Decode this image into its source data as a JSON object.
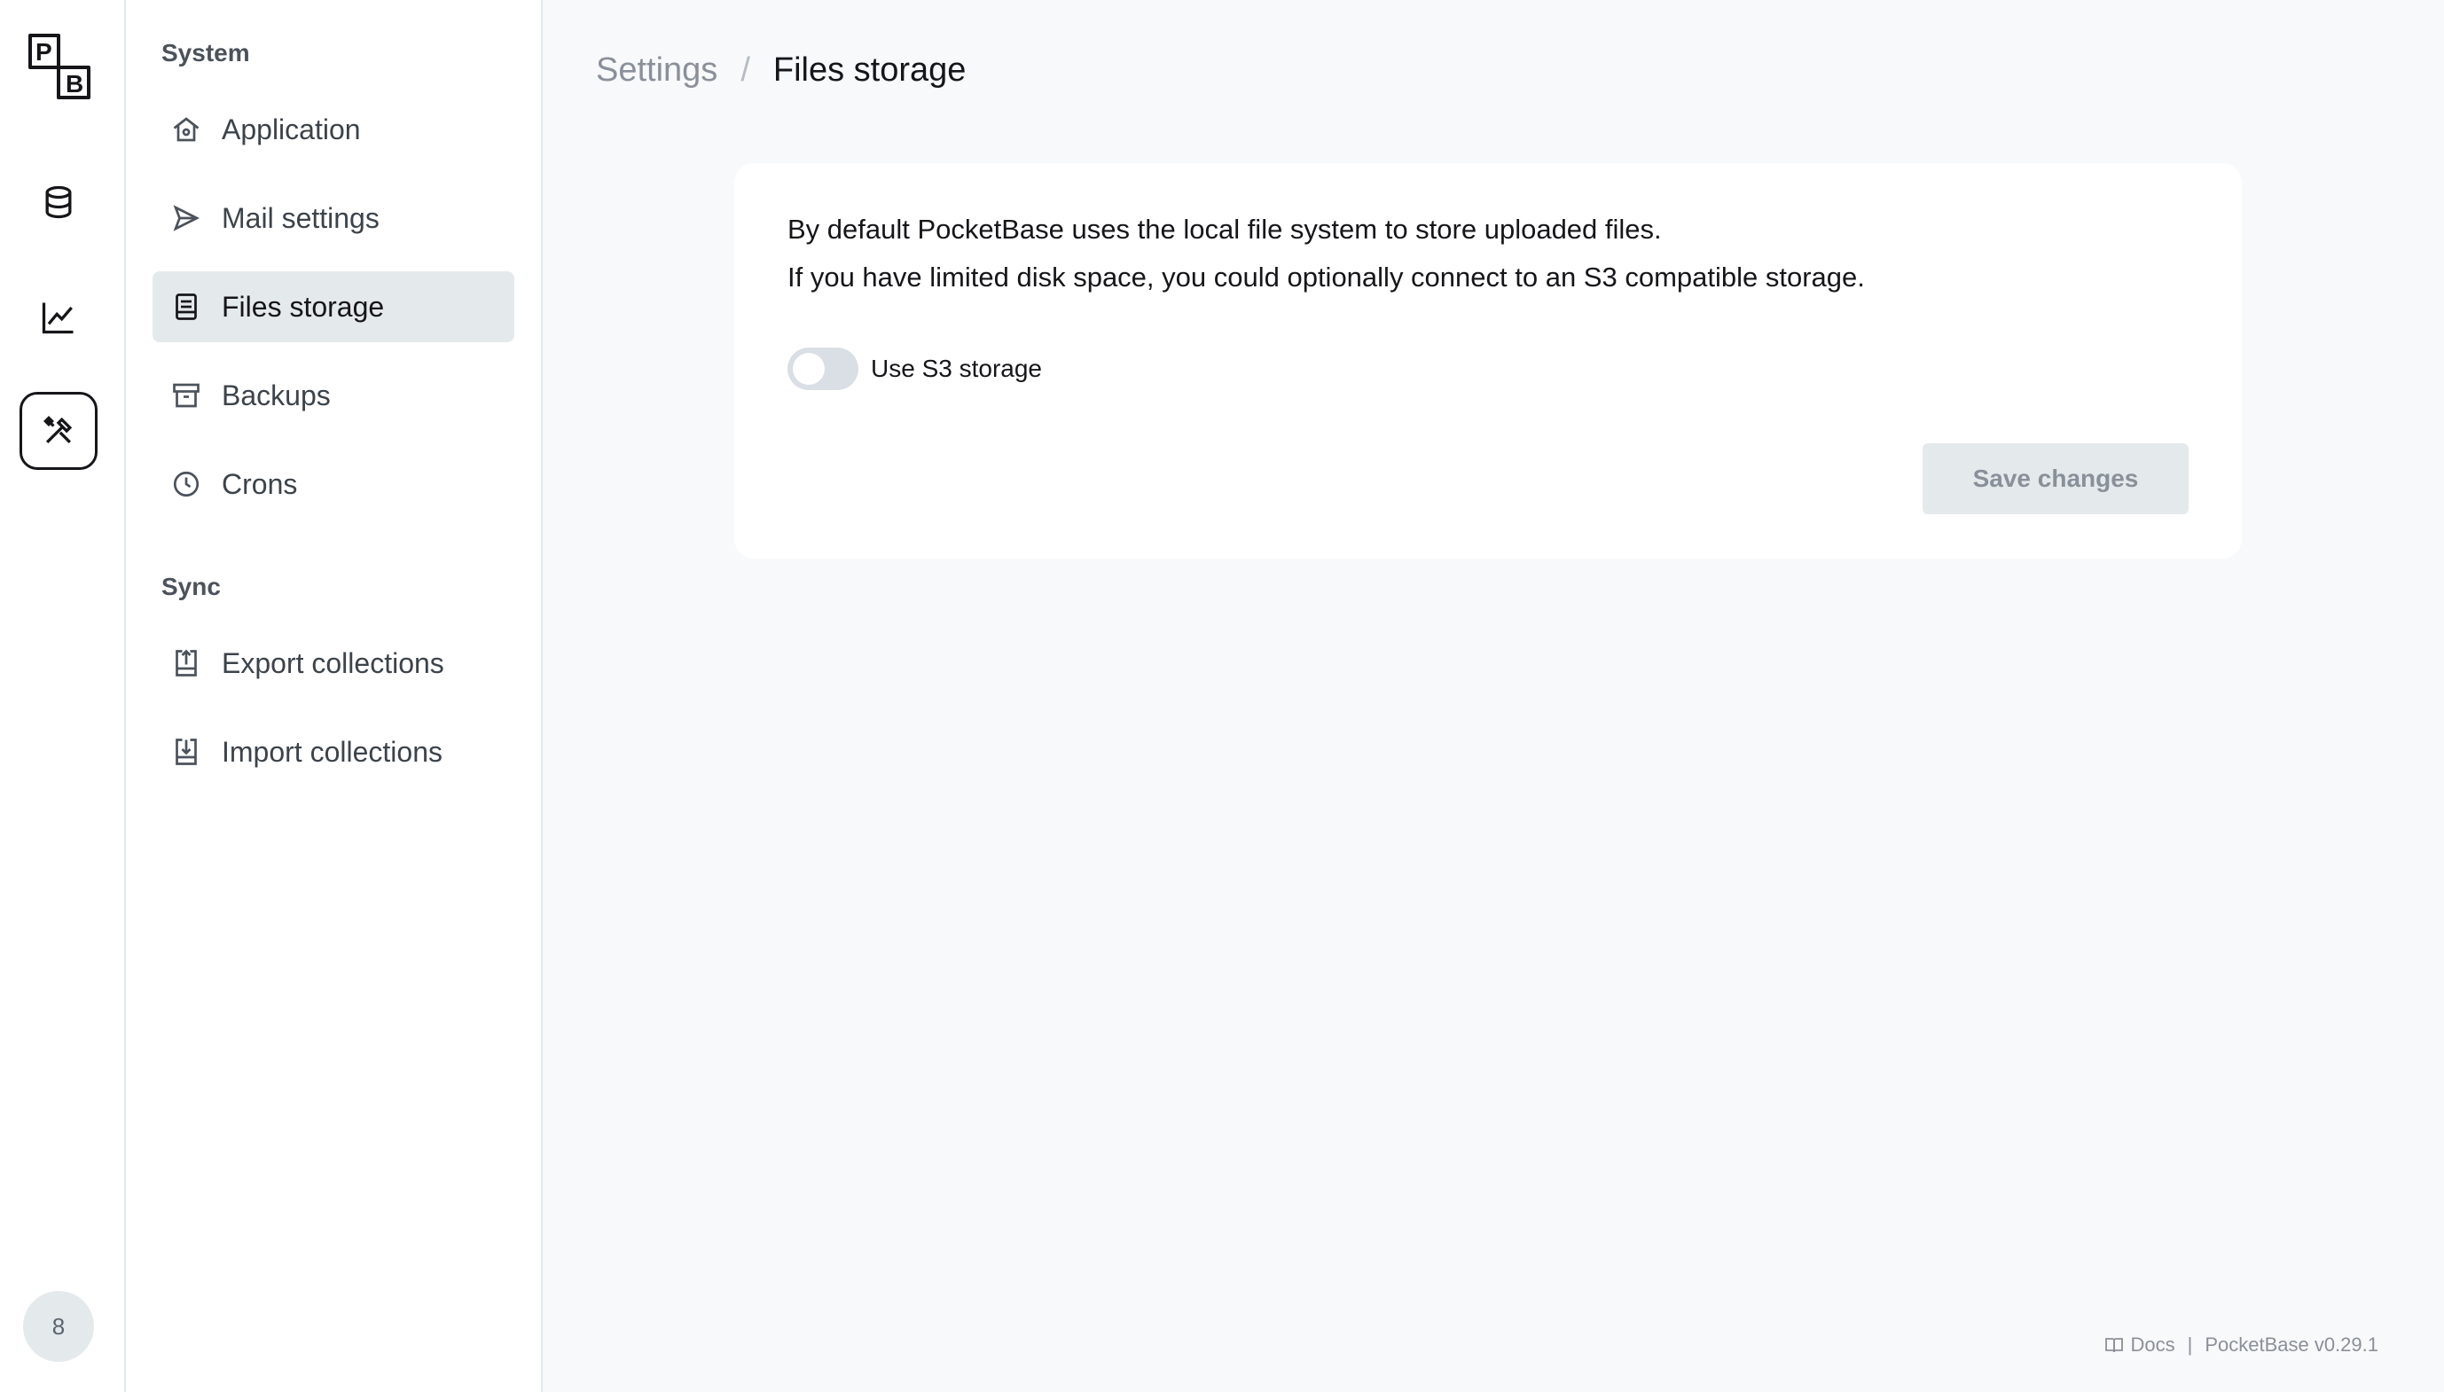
{
  "rail": {
    "logo_text_top": "P",
    "logo_text_bottom": "B",
    "nav": [
      {
        "name": "collections",
        "icon": "database-icon"
      },
      {
        "name": "logs",
        "icon": "line-chart-icon"
      },
      {
        "name": "settings",
        "icon": "tools-icon",
        "active": true
      }
    ],
    "avatar_label": "8"
  },
  "sidebar": {
    "sections": [
      {
        "title": "System",
        "items": [
          {
            "label": "Application",
            "icon": "home-icon"
          },
          {
            "label": "Mail settings",
            "icon": "send-icon"
          },
          {
            "label": "Files storage",
            "icon": "storage-icon",
            "active": true
          },
          {
            "label": "Backups",
            "icon": "archive-icon"
          },
          {
            "label": "Crons",
            "icon": "clock-icon"
          }
        ]
      },
      {
        "title": "Sync",
        "items": [
          {
            "label": "Export collections",
            "icon": "export-icon"
          },
          {
            "label": "Import collections",
            "icon": "import-icon"
          }
        ]
      }
    ]
  },
  "breadcrumb": {
    "parent": "Settings",
    "separator": "/",
    "current": "Files storage"
  },
  "panel": {
    "desc_line1": "By default PocketBase uses the local file system to store uploaded files.",
    "desc_line2": "If you have limited disk space, you could optionally connect to an S3 compatible storage.",
    "toggle_label": "Use S3 storage",
    "toggle_on": false,
    "save_label": "Save changes"
  },
  "footer": {
    "docs_label": "Docs",
    "divider": "|",
    "version": "PocketBase v0.29.1"
  },
  "colors": {
    "accent": "#16161a",
    "muted": "#8a9099",
    "active_bg": "#e4e9ec"
  }
}
